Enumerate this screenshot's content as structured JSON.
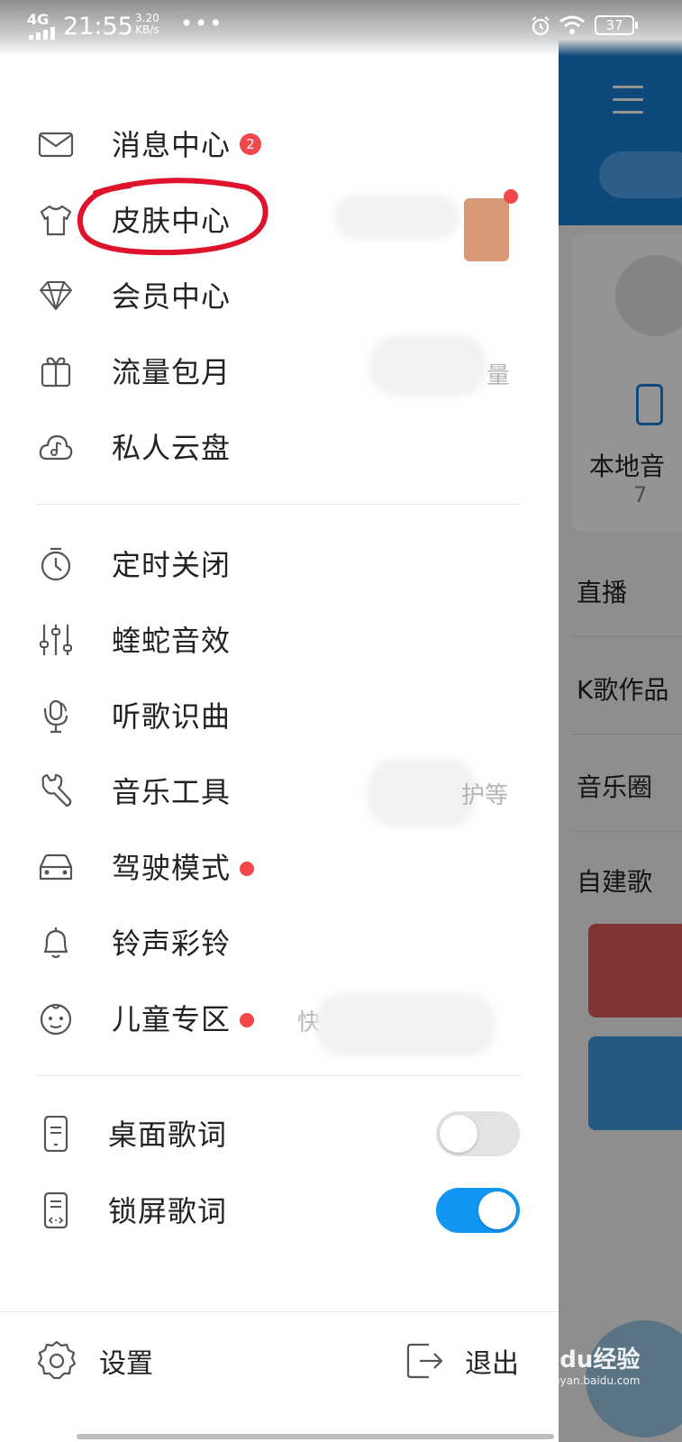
{
  "status_bar": {
    "network": "4G",
    "time": "21:55",
    "speed_value": "3.20",
    "speed_unit": "KB/s",
    "dots": "•••",
    "battery": "37"
  },
  "background": {
    "local_music_label": "本地音",
    "local_music_count": "7",
    "list": [
      "直播",
      "K歌作品",
      "音乐圈",
      "自建歌"
    ]
  },
  "menu_group1": [
    {
      "label": "消息中心",
      "icon": "mail-icon",
      "badge": "2"
    },
    {
      "label": "皮肤中心",
      "icon": "tshirt-icon"
    },
    {
      "label": "会员中心",
      "icon": "diamond-icon"
    },
    {
      "label": "流量包月",
      "icon": "gift-icon",
      "side_text": "量"
    },
    {
      "label": "私人云盘",
      "icon": "cloud-music-icon"
    }
  ],
  "menu_group2": [
    {
      "label": "定时关闭",
      "icon": "timer-icon"
    },
    {
      "label": "蝰蛇音效",
      "icon": "equalizer-icon"
    },
    {
      "label": "听歌识曲",
      "icon": "mic-icon"
    },
    {
      "label": "音乐工具",
      "icon": "wrench-icon",
      "side_text": "护等"
    },
    {
      "label": "驾驶模式",
      "icon": "car-icon",
      "dot": true
    },
    {
      "label": "铃声彩铃",
      "icon": "bell-icon"
    },
    {
      "label": "儿童专区",
      "icon": "baby-face-icon",
      "dot": true,
      "side_text": "快"
    }
  ],
  "toggles": [
    {
      "label": "桌面歌词",
      "icon": "phone-lyrics-icon",
      "on": false
    },
    {
      "label": "锁屏歌词",
      "icon": "lock-lyrics-icon",
      "on": true
    }
  ],
  "bottom": {
    "settings_label": "设置",
    "exit_label": "退出"
  },
  "watermark": {
    "brand": "Baidu经验",
    "url": "jingyan.baidu.com"
  },
  "colors": {
    "accent": "#1296f3",
    "badge_red": "#f2474b",
    "header_blue": "#1a7fd4",
    "annotation_red": "#e0132c"
  }
}
